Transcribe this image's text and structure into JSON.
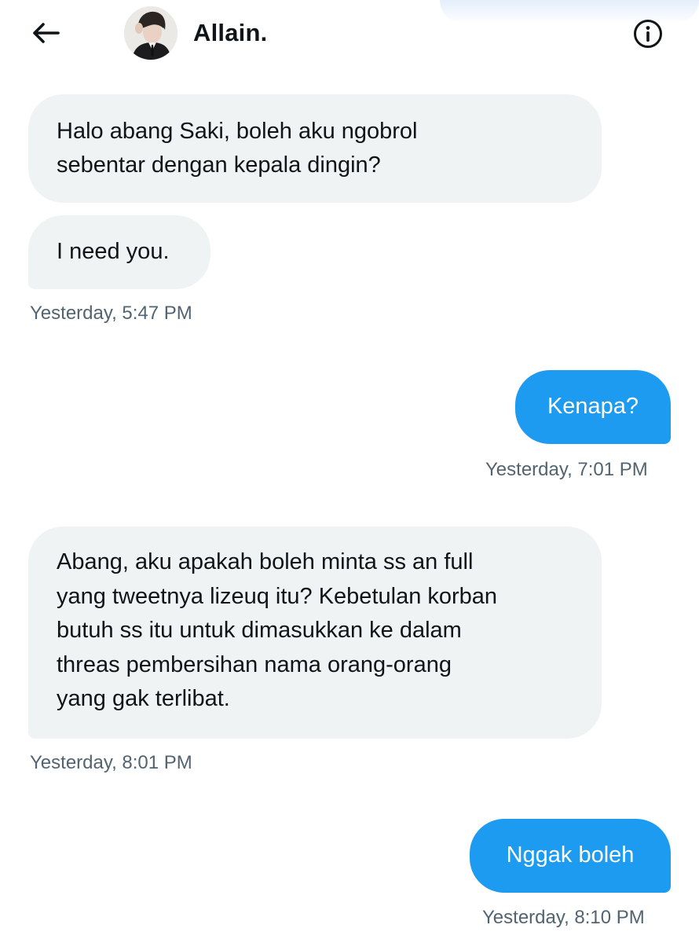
{
  "header": {
    "back_icon": "arrow-left-icon",
    "contact_name": "Allain.",
    "info_icon": "info-circle-icon"
  },
  "messages": [
    {
      "direction": "incoming",
      "lines": [
        "Halo abang Saki, boleh aku ngobrol",
        "sebentar dengan kepala dingin?"
      ]
    },
    {
      "direction": "incoming",
      "lines": [
        "I need you."
      ],
      "timestamp": "Yesterday, 5:47 PM"
    },
    {
      "direction": "outgoing",
      "lines": [
        "Kenapa?"
      ],
      "timestamp": "Yesterday, 7:01 PM"
    },
    {
      "direction": "incoming",
      "lines": [
        "Abang, aku apakah boleh minta ss an full",
        "yang tweetnya lizeuq itu? Kebetulan korban",
        "butuh ss itu untuk dimasukkan ke dalam",
        "threas pembersihan nama orang-orang",
        "yang gak terlibat."
      ],
      "timestamp": "Yesterday, 8:01 PM"
    },
    {
      "direction": "outgoing",
      "lines": [
        "Nggak boleh"
      ],
      "timestamp": "Yesterday, 8:10 PM"
    }
  ],
  "colors": {
    "incoming_bubble": "#eff3f4",
    "outgoing_bubble": "#1d9bf0",
    "timestamp_text": "#536471"
  }
}
